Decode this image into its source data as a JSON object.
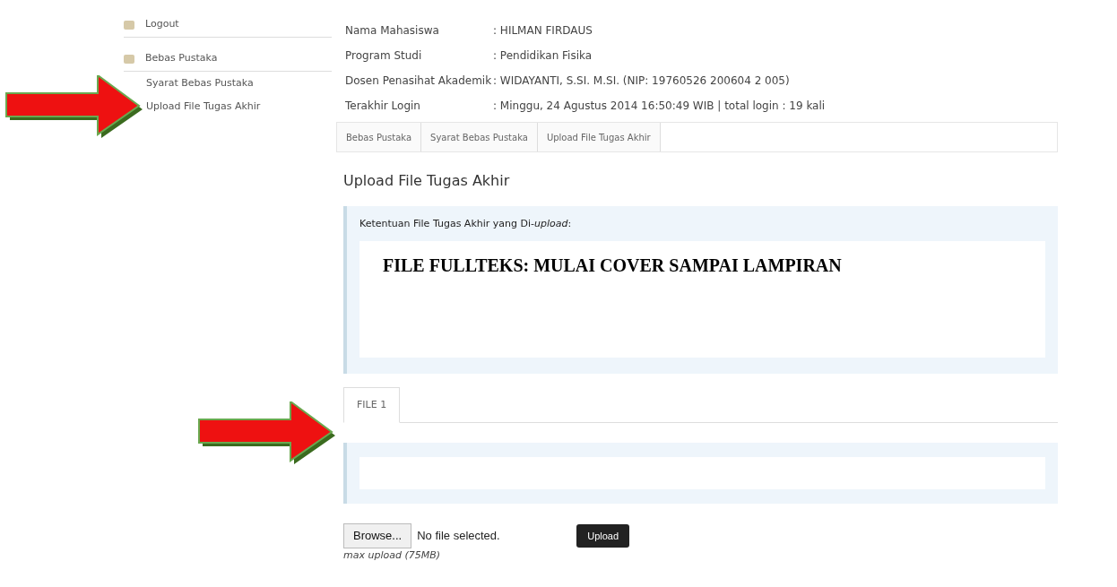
{
  "sidebar": {
    "items": [
      {
        "label": "Logout",
        "kind": "section"
      },
      {
        "label": "Bebas Pustaka",
        "kind": "section"
      },
      {
        "label": "Syarat Bebas Pustaka",
        "kind": "link"
      },
      {
        "label": "Upload File Tugas Akhir",
        "kind": "link"
      }
    ]
  },
  "profile": [
    {
      "label": "Nama Mahasiswa",
      "value": ": HILMAN FIRDAUS"
    },
    {
      "label": "Program Studi",
      "value": ": Pendidikan Fisika"
    },
    {
      "label": "Dosen Penasihat Akademik",
      "value": ": WIDAYANTI, S.SI. M.SI. (NIP: 19760526 200604 2 005)"
    },
    {
      "label": "Terakhir Login",
      "value": ": Minggu, 24 Agustus 2014 16:50:49 WIB | total login : 19 kali"
    }
  ],
  "breadcrumb": [
    "Bebas Pustaka",
    "Syarat Bebas Pustaka",
    "Upload File Tugas Akhir"
  ],
  "heading": "Upload File Tugas Akhir",
  "rules_box": {
    "title": "Ketentuan File Tugas Akhir yang Di-*upload*:",
    "note": "FILE FULLTEKS: MULAI COVER SAMPAI LAMPIRAN"
  },
  "tabs": [
    {
      "label": "FILE 1",
      "selected": true
    }
  ],
  "upload": {
    "browse": "Browse...",
    "file_status": "No file selected.",
    "submit": "Upload",
    "hint": "max upload (75MB)"
  }
}
